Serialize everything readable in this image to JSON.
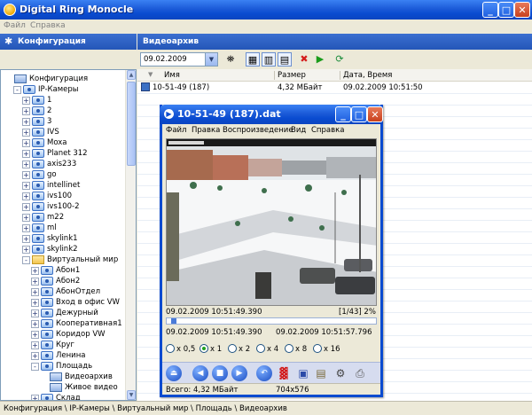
{
  "window": {
    "title": "Digital Ring Monocle"
  },
  "menu": {
    "items": [
      "Файл",
      "Справка"
    ]
  },
  "left_panel": {
    "title": "Конфигурация"
  },
  "tree": {
    "items": [
      {
        "label": "Конфигурация",
        "depth": 0,
        "icon": "pc",
        "expander": ""
      },
      {
        "label": "IP-Камеры",
        "depth": 1,
        "icon": "cam",
        "expander": "-"
      },
      {
        "label": "1",
        "depth": 2,
        "icon": "cam",
        "expander": "+"
      },
      {
        "label": "2",
        "depth": 2,
        "icon": "cam",
        "expander": "+"
      },
      {
        "label": "3",
        "depth": 2,
        "icon": "cam",
        "expander": "+"
      },
      {
        "label": "IVS",
        "depth": 2,
        "icon": "cam",
        "expander": "+"
      },
      {
        "label": "Moxa",
        "depth": 2,
        "icon": "cam",
        "expander": "+"
      },
      {
        "label": "Planet 312",
        "depth": 2,
        "icon": "cam",
        "expander": "+"
      },
      {
        "label": "axis233",
        "depth": 2,
        "icon": "cam",
        "expander": "+"
      },
      {
        "label": "go",
        "depth": 2,
        "icon": "cam",
        "expander": "+"
      },
      {
        "label": "intellinet",
        "depth": 2,
        "icon": "cam",
        "expander": "+"
      },
      {
        "label": "ivs100",
        "depth": 2,
        "icon": "cam",
        "expander": "+"
      },
      {
        "label": "ivs100-2",
        "depth": 2,
        "icon": "cam",
        "expander": "+"
      },
      {
        "label": "m22",
        "depth": 2,
        "icon": "cam",
        "expander": "+"
      },
      {
        "label": "ml",
        "depth": 2,
        "icon": "cam",
        "expander": "+"
      },
      {
        "label": "skylink1",
        "depth": 2,
        "icon": "cam",
        "expander": "+"
      },
      {
        "label": "skylink2",
        "depth": 2,
        "icon": "cam",
        "expander": "+"
      },
      {
        "label": "Виртуальный мир",
        "depth": 2,
        "icon": "folder",
        "expander": "-"
      },
      {
        "label": "Абон1",
        "depth": 3,
        "icon": "cam",
        "expander": "+"
      },
      {
        "label": "Абон2",
        "depth": 3,
        "icon": "cam",
        "expander": "+"
      },
      {
        "label": "АбонОтдел",
        "depth": 3,
        "icon": "cam",
        "expander": "+"
      },
      {
        "label": "Вход в офис VW",
        "depth": 3,
        "icon": "cam",
        "expander": "+"
      },
      {
        "label": "Дежурный",
        "depth": 3,
        "icon": "cam",
        "expander": "+"
      },
      {
        "label": "Кооперативная1",
        "depth": 3,
        "icon": "cam",
        "expander": "+"
      },
      {
        "label": "Коридор VW",
        "depth": 3,
        "icon": "cam",
        "expander": "+"
      },
      {
        "label": "Круг",
        "depth": 3,
        "icon": "cam",
        "expander": "+"
      },
      {
        "label": "Ленина",
        "depth": 3,
        "icon": "cam",
        "expander": "+"
      },
      {
        "label": "Площадь",
        "depth": 3,
        "icon": "cam",
        "expander": "-"
      },
      {
        "label": "Видеоархив",
        "depth": 4,
        "icon": "pc",
        "expander": ""
      },
      {
        "label": "Живое видео",
        "depth": 4,
        "icon": "pc",
        "expander": ""
      },
      {
        "label": "Склад",
        "depth": 3,
        "icon": "cam",
        "expander": "+"
      }
    ]
  },
  "status_bar": {
    "path": "Конфигурация \\ IP-Камеры \\ Виртуальный мир \\ Площадь \\ Видеоархив"
  },
  "right_panel": {
    "title": "Видеоархив"
  },
  "toolbar": {
    "date": "09.02.2009"
  },
  "list": {
    "columns": [
      "Имя",
      "Размер",
      "Дата, Время"
    ],
    "rows": [
      {
        "name": "10-51-49 (187)",
        "size": "4,32 МБайт",
        "datetime": "09.02.2009 10:51:50"
      }
    ]
  },
  "player": {
    "title": "10-51-49 (187).dat",
    "menu": [
      "Файл",
      "Правка",
      "Воспроизведение",
      "Вид",
      "Справка"
    ],
    "current_time": "09.02.2009 10:51:49.390",
    "frame_info": "[1/43] 2%",
    "start_time": "09.02.2009 10:51:49.390",
    "end_time": "09.02.2009 10:51:57.796",
    "speeds": [
      "x 0,5",
      "x 1",
      "x 2",
      "x 4",
      "x 8",
      "x 16"
    ],
    "selected_speed": "x 1",
    "progress_fraction": 0.02,
    "status_size": "Всего: 4,32 МБайт",
    "status_resolution": "704x576"
  }
}
